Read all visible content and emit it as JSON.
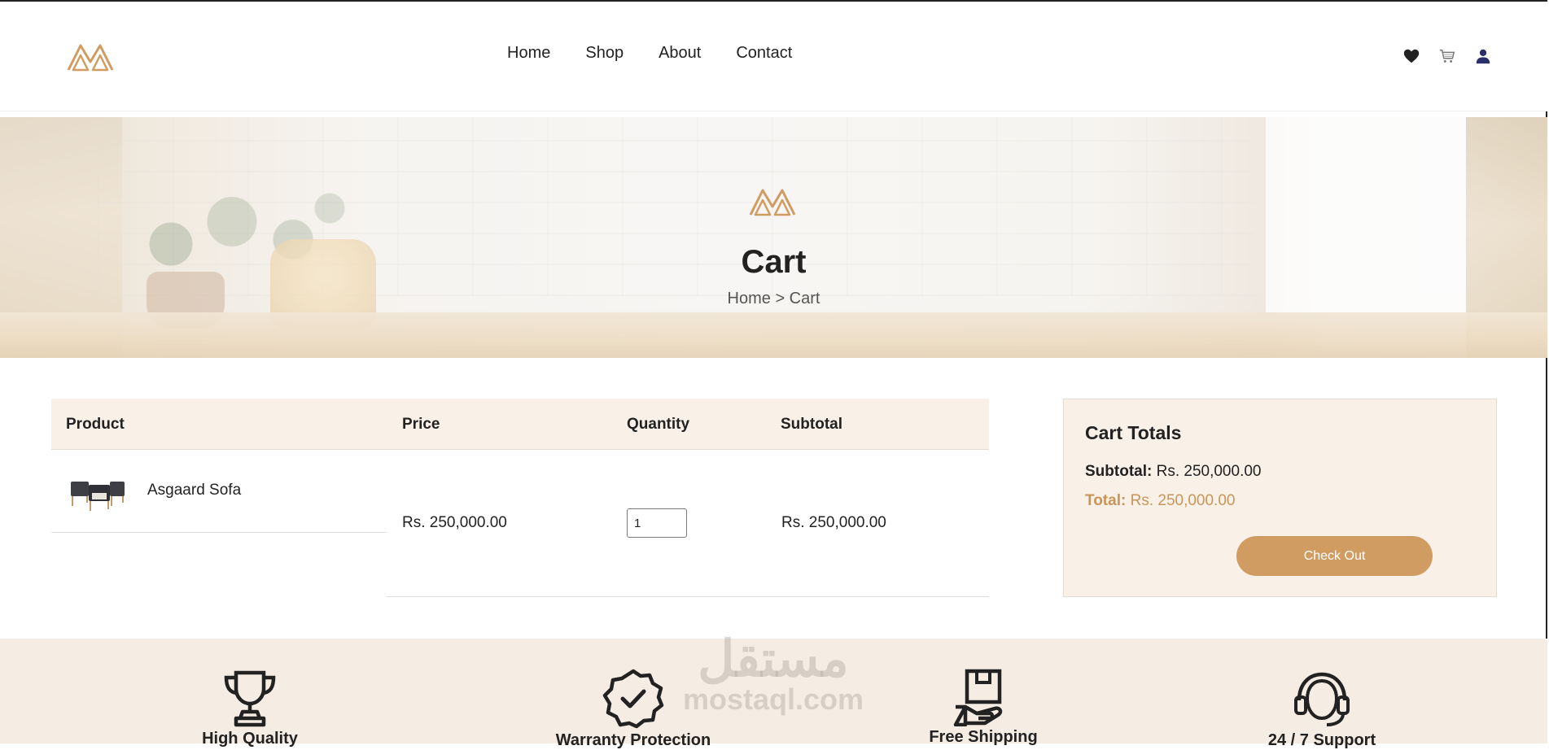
{
  "brand": {
    "logo_icon": "brand-logo-icon",
    "accent": "#c9955a"
  },
  "nav": {
    "items": [
      {
        "label": "Home"
      },
      {
        "label": "Shop"
      },
      {
        "label": "About"
      },
      {
        "label": "Contact"
      }
    ]
  },
  "header_icons": [
    "heart-icon",
    "cart-icon",
    "user-icon"
  ],
  "hero": {
    "title": "Cart",
    "breadcrumb": "Home > Cart"
  },
  "cart_table": {
    "headers": {
      "product": "Product",
      "price": "Price",
      "quantity": "Quantity",
      "subtotal": "Subtotal"
    },
    "rows": [
      {
        "product_name": "Asgaard Sofa",
        "price": "Rs. 250,000.00",
        "quantity": "1",
        "subtotal": "Rs. 250,000.00"
      }
    ]
  },
  "totals": {
    "title": "Cart Totals",
    "subtotal_label": "Subtotal:",
    "subtotal_value": "Rs. 250,000.00",
    "total_label": "Total:",
    "total_value": "Rs. 250,000.00",
    "checkout_label": "Check Out",
    "button_color": "#d19c61"
  },
  "features": [
    {
      "icon": "trophy-icon",
      "label": "High Quality"
    },
    {
      "icon": "badge-check-icon",
      "label": "Warranty Protection"
    },
    {
      "icon": "box-hand-icon",
      "label": "Free Shipping"
    },
    {
      "icon": "headset-icon",
      "label": "24 / 7 Support"
    }
  ],
  "watermark": {
    "arabic": "مستقل",
    "latin": "mostaql.com"
  }
}
